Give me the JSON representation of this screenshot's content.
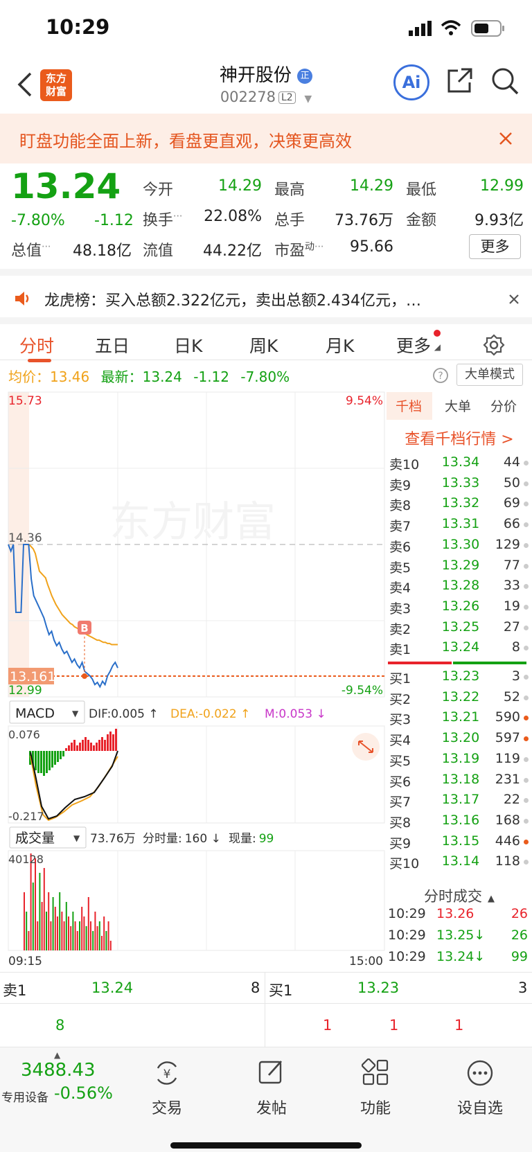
{
  "status_bar": {
    "time": "10:29"
  },
  "nav": {
    "stock_name": "神开股份",
    "badge": "正",
    "stock_code": "002278",
    "level": "L2",
    "logo_line1": "东方",
    "logo_line2": "财富",
    "ai_label": "Ai"
  },
  "banner": {
    "text": "盯盘功能全面上新，看盘更直观，决策更高效"
  },
  "quote": {
    "price": "13.24",
    "change_pct": "-7.80%",
    "change": "-1.12",
    "open_label": "今开",
    "open": "14.29",
    "high_label": "最高",
    "high": "14.29",
    "low_label": "最低",
    "low": "12.99",
    "turnover_label": "换手",
    "turnover": "22.08%",
    "volume_label": "总手",
    "volume": "73.76万",
    "amount_label": "金额",
    "amount": "9.93亿",
    "mktcap_label": "总值",
    "mktcap": "48.18亿",
    "float_label": "流值",
    "float": "44.22亿",
    "pe_label": "市盈",
    "pe_sup": "动",
    "pe": "95.66",
    "more": "更多"
  },
  "dragon": {
    "text": "龙虎榜：买入总额2.322亿元，卖出总额2.434亿元，…"
  },
  "tabs": [
    "分时",
    "五日",
    "日K",
    "周K",
    "月K",
    "更多"
  ],
  "info": {
    "avg_label": "均价：",
    "avg": "13.46",
    "last_label": "最新：",
    "last": "13.24",
    "chg": "-1.12",
    "pct": "-7.80%",
    "big_mode": "大单模式"
  },
  "chart_data": {
    "type": "line",
    "title": "",
    "y_max_label": "15.73",
    "y_min_label": "12.99",
    "pct_max_label": "9.54%",
    "pct_min_label": "-9.54%",
    "prev_close_label": "14.36",
    "cursor_label": "13.161",
    "marker": "B",
    "x_start": "09:15",
    "x_end": "15:00",
    "ylim": [
      12.99,
      15.73
    ],
    "series": [
      {
        "values": [
          14.36,
          14.3,
          14.36,
          13.75,
          13.75,
          13.75,
          14.36,
          14.36,
          14.36,
          14.05,
          13.9,
          13.85,
          13.8,
          13.75,
          13.7,
          13.62,
          13.55,
          13.58,
          13.5,
          13.45,
          13.48,
          13.42,
          13.38,
          13.4,
          13.35,
          13.3,
          13.33,
          13.28,
          13.25,
          13.3,
          13.22,
          13.2,
          13.18,
          13.15,
          13.1,
          13.12,
          13.08,
          13.13,
          13.1,
          13.18,
          13.22,
          13.27,
          13.3,
          13.25
        ]
      },
      {
        "values": [
          14.36,
          14.34,
          14.32,
          14.28,
          14.2,
          14.12,
          14.1,
          14.08,
          14.06,
          14.0,
          13.95,
          13.9,
          13.86,
          13.82,
          13.79,
          13.76,
          13.73,
          13.71,
          13.69,
          13.67,
          13.65,
          13.64,
          13.62,
          13.61,
          13.6,
          13.58,
          13.57,
          13.56,
          13.55,
          13.54,
          13.53,
          13.52,
          13.51,
          13.5,
          13.5,
          13.49,
          13.48,
          13.48,
          13.47,
          13.47,
          13.46,
          13.46,
          13.46,
          13.46
        ]
      }
    ]
  },
  "macd": {
    "label": "MACD",
    "dif_label": "DIF:",
    "dif": "0.005",
    "dea_label": "DEA:",
    "dea": "-0.022",
    "m_label": "M:",
    "m": "0.053",
    "max_label": "0.076",
    "min_label": "-0.217",
    "hist": [
      -0.05,
      -0.06,
      -0.07,
      -0.08,
      -0.08,
      -0.09,
      -0.08,
      -0.07,
      -0.06,
      -0.05,
      -0.04,
      -0.03,
      -0.02,
      0.01,
      0.02,
      0.03,
      0.04,
      0.02,
      0.03,
      0.04,
      0.05,
      0.04,
      0.03,
      0.02,
      0.03,
      0.04,
      0.05,
      0.04,
      0.06,
      0.07,
      0.06,
      0.08
    ]
  },
  "volume": {
    "label": "成交量",
    "total": "73.76万",
    "tick_label": "分时量:",
    "tick": "160",
    "now_label": "现量:",
    "now": "99",
    "max_label": "40128",
    "bars": [
      0.6,
      0.4,
      0.2,
      1.0,
      0.7,
      0.95,
      0.3,
      0.8,
      0.5,
      0.85,
      0.4,
      0.6,
      0.3,
      0.55,
      0.45,
      0.35,
      0.6,
      0.4,
      0.3,
      0.5,
      0.35,
      0.25,
      0.4,
      0.3,
      0.2,
      0.3,
      0.45,
      0.35,
      0.25,
      0.55,
      0.3,
      0.2,
      0.4,
      0.25,
      0.3,
      0.15,
      0.35,
      0.2,
      0.3,
      0.1
    ]
  },
  "orderbook": {
    "tabs": [
      "千档",
      "大单",
      "分价"
    ],
    "link": "查看千档行情 >",
    "asks": [
      {
        "label": "卖10",
        "price": "13.34",
        "vol": "44",
        "dot": "gray"
      },
      {
        "label": "卖9",
        "price": "13.33",
        "vol": "50",
        "dot": "gray"
      },
      {
        "label": "卖8",
        "price": "13.32",
        "vol": "69",
        "dot": "gray"
      },
      {
        "label": "卖7",
        "price": "13.31",
        "vol": "66",
        "dot": "gray"
      },
      {
        "label": "卖6",
        "price": "13.30",
        "vol": "129",
        "dot": "gray"
      },
      {
        "label": "卖5",
        "price": "13.29",
        "vol": "77",
        "dot": "gray"
      },
      {
        "label": "卖4",
        "price": "13.28",
        "vol": "33",
        "dot": "gray"
      },
      {
        "label": "卖3",
        "price": "13.26",
        "vol": "19",
        "dot": "gray"
      },
      {
        "label": "卖2",
        "price": "13.25",
        "vol": "27",
        "dot": "gray"
      },
      {
        "label": "卖1",
        "price": "13.24",
        "vol": "8",
        "dot": "gray"
      }
    ],
    "bids": [
      {
        "label": "买1",
        "price": "13.23",
        "vol": "3",
        "dot": "gray"
      },
      {
        "label": "买2",
        "price": "13.22",
        "vol": "52",
        "dot": "gray"
      },
      {
        "label": "买3",
        "price": "13.21",
        "vol": "590",
        "dot": "orange"
      },
      {
        "label": "买4",
        "price": "13.20",
        "vol": "597",
        "dot": "orange"
      },
      {
        "label": "买5",
        "price": "13.19",
        "vol": "119",
        "dot": "gray"
      },
      {
        "label": "买6",
        "price": "13.18",
        "vol": "231",
        "dot": "gray"
      },
      {
        "label": "买7",
        "price": "13.17",
        "vol": "22",
        "dot": "gray"
      },
      {
        "label": "买8",
        "price": "13.16",
        "vol": "168",
        "dot": "gray"
      },
      {
        "label": "买9",
        "price": "13.15",
        "vol": "446",
        "dot": "orange"
      },
      {
        "label": "买10",
        "price": "13.14",
        "vol": "118",
        "dot": "gray"
      }
    ],
    "time_sales_label": "分时成交",
    "time_sales": [
      {
        "time": "10:29",
        "price": "13.26",
        "vol": "26",
        "color": "red"
      },
      {
        "time": "10:29",
        "price": "13.25↓",
        "vol": "26",
        "color": "green"
      },
      {
        "time": "10:29",
        "price": "13.24↓",
        "vol": "99",
        "color": "green"
      }
    ]
  },
  "strip": {
    "sell_label": "卖1",
    "sell_price": "13.24",
    "sell_vol": "8",
    "buy_label": "买1",
    "buy_price": "13.23",
    "buy_vol": "3",
    "row2_a": "8",
    "row2_b": "1",
    "row2_c": "1",
    "row2_d": "1"
  },
  "tabbar": {
    "index_value": "3488.43",
    "index_name": "专用设备",
    "index_change": "-0.56%",
    "items": [
      "交易",
      "发帖",
      "功能",
      "设自选"
    ]
  },
  "colors": {
    "red": "#e8232b",
    "green": "#14a113",
    "accent": "#e8532b",
    "avg_line": "#f0a21a",
    "price_line": "#2a6fc9"
  }
}
